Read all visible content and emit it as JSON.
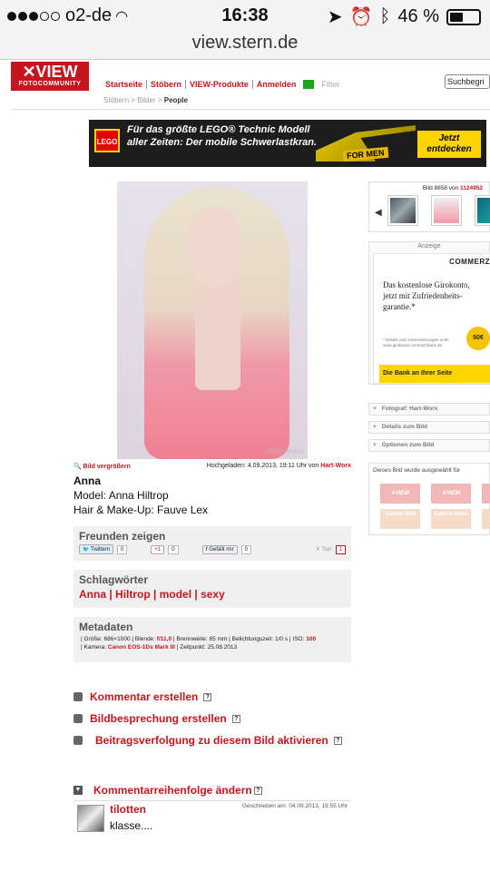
{
  "status_bar": {
    "carrier": "o2-de",
    "time": "16:38",
    "battery": "46 %",
    "battery_level": 0.46
  },
  "browser": {
    "url": "view.stern.de"
  },
  "site": {
    "logo_main": "✕VIEW",
    "logo_sub": "FOTOCOMMUNITY",
    "nav": [
      "Startseite",
      "Stöbern",
      "VIEW-Produkte",
      "Anmelden"
    ],
    "filter_label": "Filter",
    "search_value": "Suchbegri",
    "breadcrumb": [
      "Stöbern",
      "Bilder",
      "People"
    ]
  },
  "banner": {
    "brand": "LEGO",
    "text": "Für das größte LEGO® Technic Modell aller Zeiten: Der mobile Schwerlastkran.",
    "tag": "FOR MEN",
    "cta": "Jetzt entdecken"
  },
  "photo": {
    "enlarge": "Bild vergrößern",
    "uploaded_prefix": "Hochgeladen: 4.09.2013, 19:11 Uhr von",
    "uploader": "Hart-Worx",
    "title": "Anna",
    "line1": "Model: Anna Hiltrop",
    "line2": "Hair & Make-Up: Fauve Lex"
  },
  "share": {
    "heading": "Freunden zeigen",
    "twitter": "Twittern",
    "twitter_count": "0",
    "gplus": "+1",
    "gplus_count": "0",
    "fb_like": "Gefällt mir",
    "fb_count": "0",
    "top_label": "Top!",
    "top_count": "1"
  },
  "tags": {
    "heading": "Schlagwörter",
    "text": "Anna | Hiltrop | model | sexy"
  },
  "metadata": {
    "heading": "Metadaten",
    "line1_a": "| Größe: 686×1000 | Blende:",
    "aperture": "f/11,0",
    "line1_b": "| Brennweite: 85 mm | Belichtungszeit: 1/0 s | ISO:",
    "iso": "100",
    "line2_a": "| Kamera:",
    "camera": "Canon EOS-1Ds Mark III",
    "line2_b": "| Zeitpunkt: 25.08.2013"
  },
  "actions": [
    "Kommentar erstellen",
    "Bildbesprechung erstellen",
    "Beitragsverfolgung zu diesem Bild aktivieren"
  ],
  "comments": {
    "order_label": "Kommentarreihenfolge ändern",
    "items": [
      {
        "user": "tilotten",
        "when": "Geschrieben am: 04.09.2013, 19:55 Uhr",
        "text": "klasse...."
      }
    ]
  },
  "sidebar": {
    "counter_prefix": "Bild 8858 von",
    "counter_total": "1124952",
    "ad_label": "Anzeige",
    "ad_brand": "COMMERZ",
    "ad_headline": "Das kostenlose Girokonto, jetzt mit Zufriedenheits-garantie.*",
    "ad_small": "* Details und Voraussetzungen unter www.girokonto.commerzbank.de",
    "ad_badge": "50€",
    "ad_cta": "Die Bank an Ihrer Seite",
    "accordion": [
      "Fotograf: Hart-Worx",
      "Details zum Bild",
      "Optionen zum Bild"
    ],
    "chosen_title": "Dieses Bild wurde ausgewählt für",
    "chosen_badges": [
      "✕VIEW",
      "✕VIEW",
      "Galerie Bild",
      "Galerie Serie"
    ]
  },
  "colors": {
    "accent_red": "#c4161c",
    "lego_yellow": "#ffd500",
    "commerz_yellow": "#ffd500"
  }
}
